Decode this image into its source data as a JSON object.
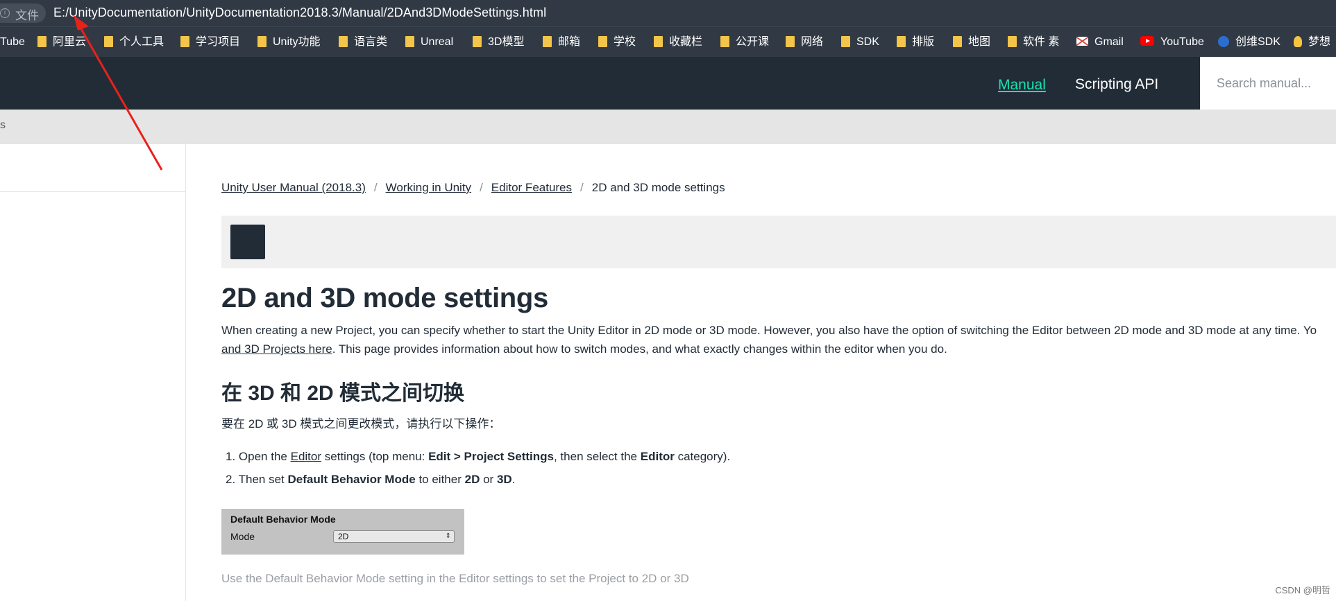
{
  "address_bar": {
    "info_glyph": "i",
    "file_label": "文件",
    "url": "E:/UnityDocumentation/UnityDocumentation2018.3/Manual/2DAnd3DModeSettings.html"
  },
  "bookmarks": [
    {
      "label": "Tube",
      "icon": "none"
    },
    {
      "label": "阿里云",
      "icon": "folder-icon"
    },
    {
      "label": "个人工具",
      "icon": "folder-icon"
    },
    {
      "label": "学习项目",
      "icon": "folder-icon"
    },
    {
      "label": "Unity功能",
      "icon": "folder-icon"
    },
    {
      "label": "语言类",
      "icon": "folder-icon"
    },
    {
      "label": "Unreal",
      "icon": "folder-icon"
    },
    {
      "label": "3D模型",
      "icon": "folder-icon"
    },
    {
      "label": "邮箱",
      "icon": "folder-icon"
    },
    {
      "label": "学校",
      "icon": "folder-icon"
    },
    {
      "label": "收藏栏",
      "icon": "folder-icon"
    },
    {
      "label": "公开课",
      "icon": "folder-icon"
    },
    {
      "label": "网络",
      "icon": "folder-icon"
    },
    {
      "label": "SDK",
      "icon": "folder-icon"
    },
    {
      "label": "排版",
      "icon": "folder-icon"
    },
    {
      "label": "地图",
      "icon": "folder-icon"
    },
    {
      "label": "软件 素",
      "icon": "folder-icon"
    },
    {
      "label": "Gmail",
      "icon": "gmail-icon"
    },
    {
      "label": "YouTube",
      "icon": "youtube-icon"
    },
    {
      "label": "创维SDK",
      "icon": "globe-icon"
    },
    {
      "label": "梦想",
      "icon": "bulb-icon"
    }
  ],
  "site_header": {
    "nav_manual": "Manual",
    "nav_scripting_api": "Scripting API",
    "search_placeholder": "Search manual..."
  },
  "band_edge_text": "s",
  "breadcrumb": {
    "items": [
      "Unity User Manual (2018.3)",
      "Working in Unity",
      "Editor Features"
    ],
    "current": "2D and 3D mode settings",
    "separator": "/"
  },
  "content": {
    "title": "2D and 3D mode settings",
    "intro_line1": "When creating a new Project, you can specify whether to start the Unity Editor in 2D mode or 3D mode. However, you also have the option of switching the Editor between 2D mode and 3D mode at any time. Yo",
    "intro_link": "and 3D Projects here",
    "intro_line2_rest": ". This page provides information about how to switch modes, and what exactly changes within the editor when you do.",
    "section_heading": "在 3D 和 2D 模式之间切换",
    "section_intro": "要在 2D 或 3D 模式之间更改模式，请执行以下操作：",
    "step1": {
      "num": "1.",
      "pre": "Open the",
      "link": "Editor",
      "mid": "settings (top menu:",
      "bold1": "Edit > Project Settings",
      "mid2": ", then select the",
      "bold2": "Editor",
      "post": "category)."
    },
    "step2": {
      "num": "2.",
      "pre": "Then set",
      "bold1": "Default Behavior Mode",
      "mid": "to either",
      "bold2": "2D",
      "or": "or",
      "bold3": "3D",
      "post": "."
    },
    "settings_image": {
      "title": "Default Behavior Mode",
      "label": "Mode",
      "value": "2D"
    },
    "caption": "Use the Default Behavior Mode setting in the Editor settings to set the Project to 2D or 3D"
  },
  "watermark": "CSDN @明哲",
  "colors": {
    "chrome_bg": "#303944",
    "site_header_bg": "#222c37",
    "accent_teal": "#19e3b1",
    "annotation_arrow": "#e8221b"
  }
}
